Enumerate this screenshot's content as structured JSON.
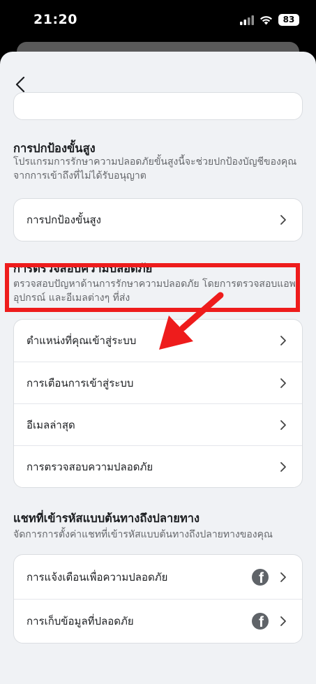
{
  "status": {
    "time": "21:20",
    "battery": "83"
  },
  "sections": {
    "advanced": {
      "title": "การปกป้องขั้นสูง",
      "description": "โปรแกรมการรักษาความปลอดภัยขั้นสูงนี้จะช่วยปกป้องบัญชีของคุณจากการเข้าถึงที่ไม่ได้รับอนุญาต",
      "rows": [
        {
          "label": "การปกป้องขั้นสูง"
        }
      ]
    },
    "checkup": {
      "title": "การตรวจสอบความปลอดภัย",
      "description": "ตรวจสอบปัญหาด้านการรักษาความปลอดภัย โดยการตรวจสอบแอพ อุปกรณ์ และอีเมลต่างๆ ที่ส่ง",
      "rows": [
        {
          "label": "ตำแหน่งที่คุณเข้าสู่ระบบ"
        },
        {
          "label": "การเตือนการเข้าสู่ระบบ"
        },
        {
          "label": "อีเมลล่าสุด"
        },
        {
          "label": "การตรวจสอบความปลอดภัย"
        }
      ]
    },
    "e2ee": {
      "title": "แชทที่เข้ารหัสแบบต้นทางถึงปลายทาง",
      "description": "จัดการการตั้งค่าแชทที่เข้ารหัสแบบต้นทางถึงปลายทางของคุณ",
      "rows": [
        {
          "label": "การแจ้งเตือนเพื่อความปลอดภัย",
          "icon": "facebook-icon"
        },
        {
          "label": "การเก็บข้อมูลที่ปลอดภัย",
          "icon": "facebook-icon"
        }
      ]
    }
  },
  "annotation": {
    "color": "#ee1c1c"
  },
  "colors": {
    "background": "#f0f2f5",
    "card": "#ffffff",
    "secondary_text": "#65676b"
  }
}
